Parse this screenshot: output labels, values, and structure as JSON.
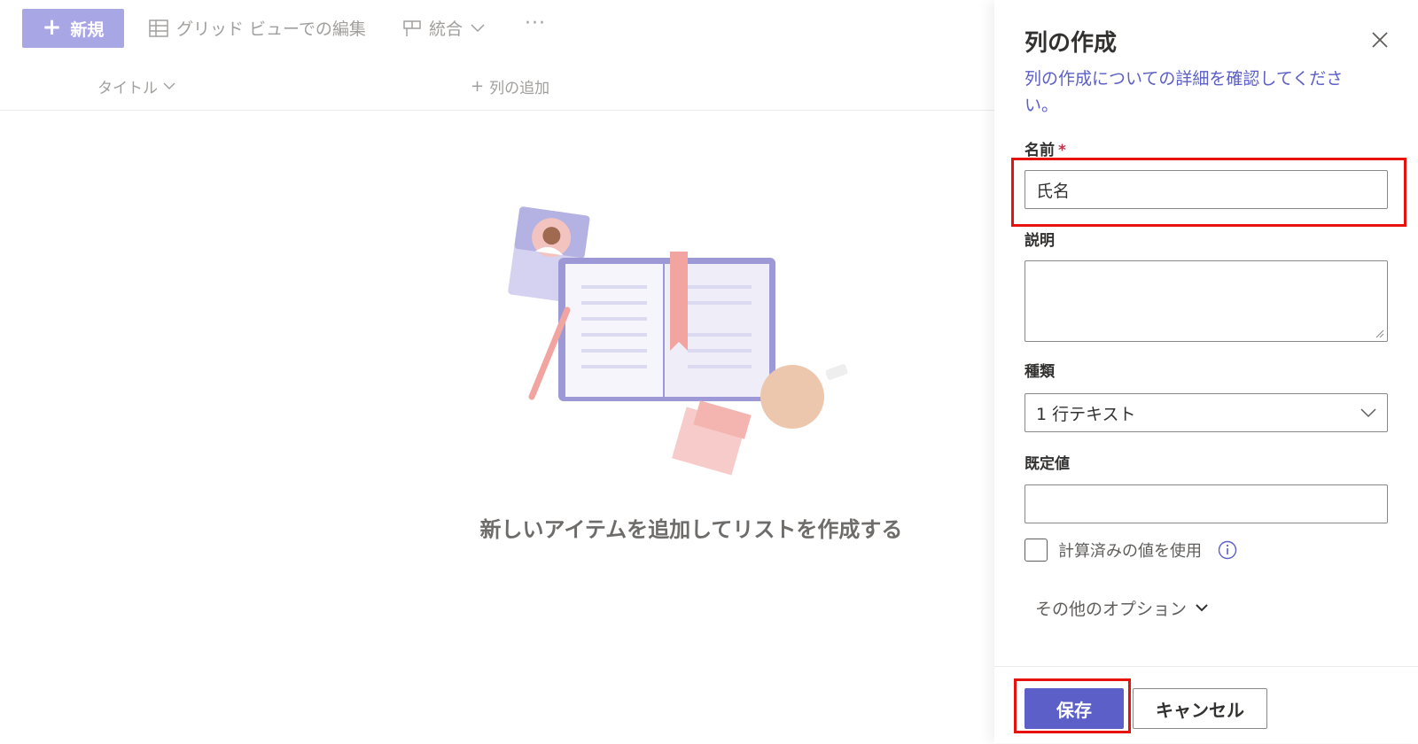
{
  "toolbar": {
    "new_label": "新規",
    "grid_edit_label": "グリッド ビューでの編集",
    "merge_label": "統合",
    "more_label": "···"
  },
  "list": {
    "column_title": "タイトル",
    "add_column": "列の追加",
    "empty_message": "新しいアイテムを追加してリストを作成する"
  },
  "panel": {
    "title": "列の作成",
    "help_link": "列の作成についての詳細を確認してください。",
    "name_label": "名前",
    "required_mark": "*",
    "name_value": "氏名",
    "description_label": "説明",
    "description_value": "",
    "type_label": "種類",
    "type_value": "1 行テキスト",
    "default_label": "既定値",
    "default_value": "",
    "calculated_label": "計算済みの値を使用",
    "more_options": "その他のオプション",
    "save_label": "保存",
    "cancel_label": "キャンセル"
  },
  "colors": {
    "accent": "#5b5fc7",
    "new_button": "#a9a6e6",
    "highlight": "#e8120c"
  }
}
